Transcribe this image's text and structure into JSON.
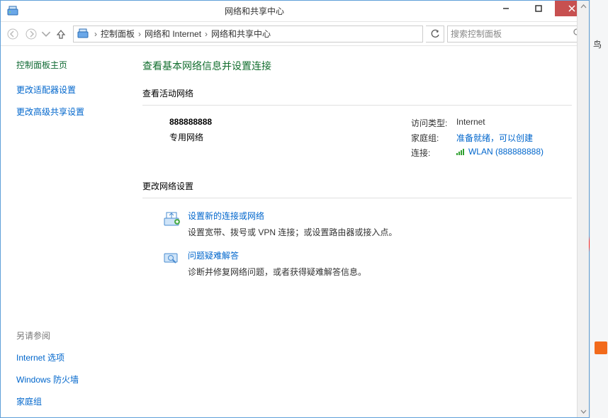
{
  "titlebar": {
    "title": "网络和共享中心"
  },
  "breadcrumb": {
    "items": [
      "控制面板",
      "网络和 Internet",
      "网络和共享中心"
    ]
  },
  "search": {
    "placeholder": "搜索控制面板"
  },
  "sidebar": {
    "home": "控制面板主页",
    "links": [
      "更改适配器设置",
      "更改高级共享设置"
    ],
    "seealso_title": "另请参阅",
    "seealso": [
      "Internet 选项",
      "Windows 防火墙",
      "家庭组"
    ]
  },
  "content": {
    "heading": "查看基本网络信息并设置连接",
    "active_title": "查看活动网络",
    "network": {
      "name": "888888888",
      "type": "专用网络",
      "rows": {
        "access_label": "访问类型:",
        "access_value": "Internet",
        "homegroup_label": "家庭组:",
        "homegroup_value": "准备就绪，可以创建",
        "conn_label": "连接:",
        "conn_value": "WLAN (888888888)"
      }
    },
    "change_title": "更改网络设置",
    "options": [
      {
        "title": "设置新的连接或网络",
        "desc": "设置宽带、拨号或 VPN 连接；或设置路由器或接入点。"
      },
      {
        "title": "问题疑难解答",
        "desc": "诊断并修复网络问题，或者获得疑难解答信息。"
      }
    ]
  },
  "rightstrip": {
    "char": "鸟"
  }
}
